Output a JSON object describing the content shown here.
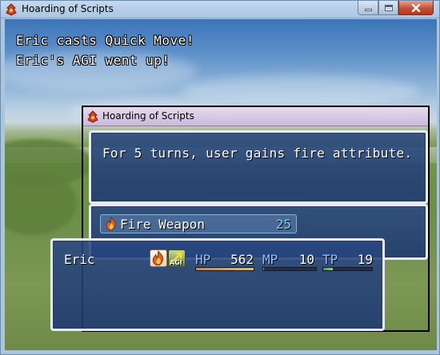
{
  "window": {
    "title": "Hoarding of Scripts",
    "caption_min": "",
    "caption_max": "",
    "caption_close": "x"
  },
  "battle_log": {
    "line1": "Eric casts Quick Move!",
    "line2": "Eric's AGI went up!"
  },
  "inner_window": {
    "title": "Hoarding of Scripts"
  },
  "help": {
    "text": "For 5 turns, user gains fire attribute."
  },
  "skill_list": {
    "items": [
      {
        "name": "Fire Weapon",
        "cost": "25",
        "icon": "fire-icon"
      }
    ]
  },
  "status": {
    "actor": "Eric",
    "states": [
      {
        "icon": "fire-icon"
      },
      {
        "icon": "agi-up-icon",
        "label": "AGI"
      }
    ],
    "hp": {
      "label": "HP",
      "value": "562",
      "fill": 1.0,
      "color_a": "#e08030",
      "color_b": "#f0c040"
    },
    "mp": {
      "label": "MP",
      "value": "10",
      "fill": 0.02,
      "color_a": "#4080e0",
      "color_b": "#40c0f0"
    },
    "tp": {
      "label": "TP",
      "value": "19",
      "fill": 0.19,
      "color_a": "#40a040",
      "color_b": "#80e080"
    }
  },
  "colors": {
    "gauge_label": "#8fc0ff",
    "skill_cost": "#6fd0f0",
    "window_bg": "#284682"
  }
}
